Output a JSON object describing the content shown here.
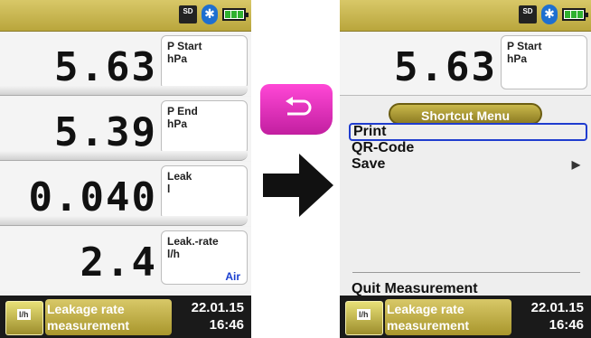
{
  "left_screen": {
    "status": {
      "sd": "SD"
    },
    "rows": [
      {
        "value": "5.63",
        "label1": "P Start",
        "label2": "hPa"
      },
      {
        "value": "5.39",
        "label1": "P End",
        "label2": "hPa"
      },
      {
        "value": "0.040",
        "label1": "Leak",
        "label2": "l"
      },
      {
        "value": "2.4",
        "label1": "Leak.-rate",
        "label2": "l/h",
        "gas": "Air"
      }
    ],
    "bottom": {
      "title_line1": "Leakage rate",
      "title_line2": "measurement",
      "date": "22.01.15",
      "time": "16:46",
      "logo_text": "l/h"
    }
  },
  "right_screen": {
    "status": {
      "sd": "SD"
    },
    "row": {
      "value": "5.63",
      "label1": "P Start",
      "label2": "hPa"
    },
    "menu": {
      "header": "Shortcut Menu",
      "items": [
        {
          "label": "Print",
          "selected": true
        },
        {
          "label": "QR-Code"
        },
        {
          "label": "Save",
          "has_submenu": true
        }
      ],
      "quit": "Quit Measurement"
    },
    "bottom": {
      "title_line1": "Leakage rate",
      "title_line2": "measurement",
      "date": "22.01.15",
      "time": "16:46",
      "logo_text": "l/h"
    }
  },
  "colors": {
    "back_button": "#e02cc0",
    "menu_header": "#b3a23a",
    "selection": "#1f3ccf",
    "gas_text": "#1a3fd0"
  },
  "icons": {
    "back": "return-arrow-icon",
    "transition": "right-arrow-icon",
    "bluetooth": "bluetooth-icon",
    "battery": "battery-icon"
  }
}
